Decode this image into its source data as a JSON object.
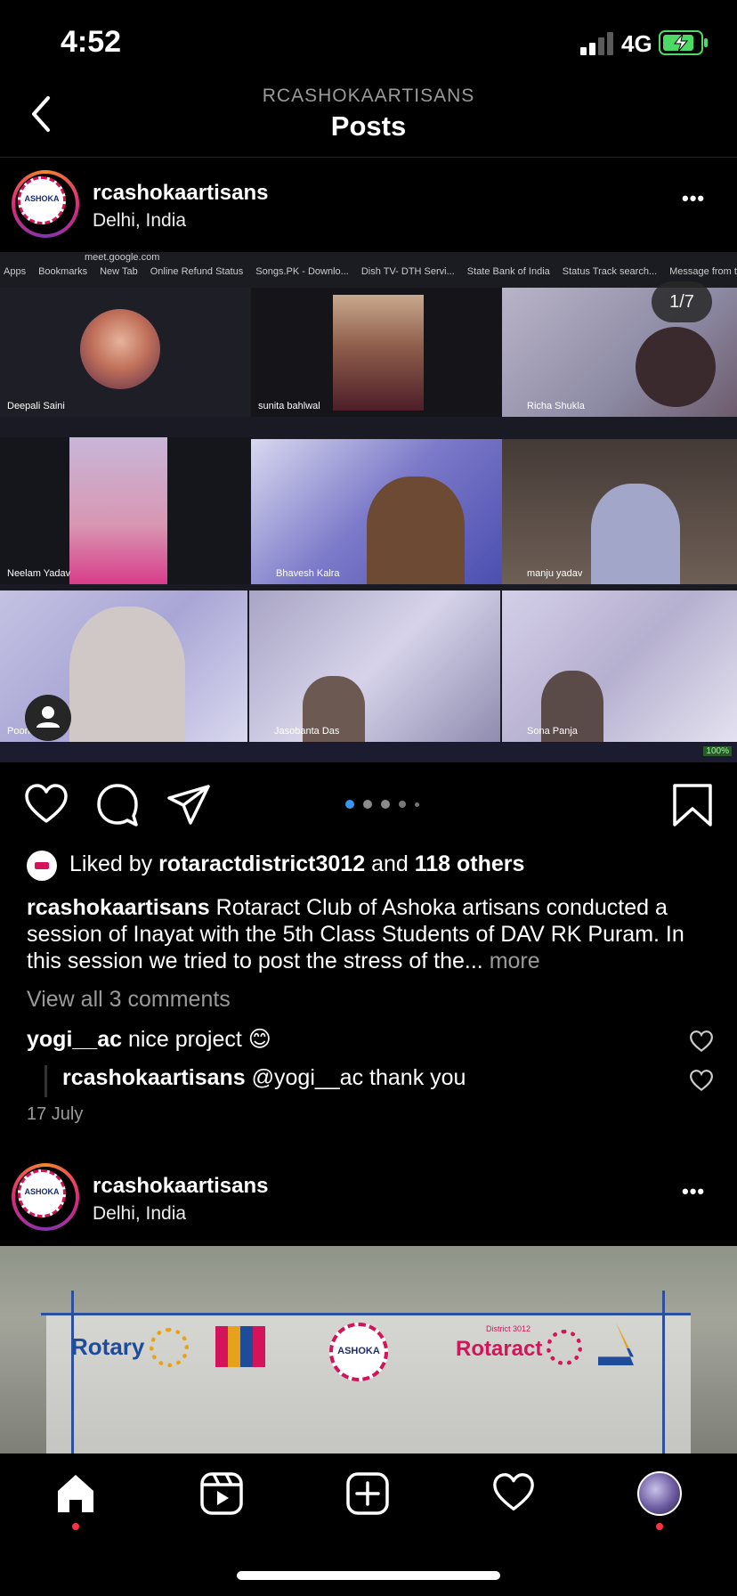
{
  "status_bar": {
    "time": "4:52",
    "network": "4G"
  },
  "header": {
    "account": "RCASHOKAARTISANS",
    "title": "Posts"
  },
  "post1": {
    "username": "rcashokaartisans",
    "location": "Delhi, India",
    "more": "•••",
    "image_counter": "1/7",
    "meeting": {
      "url": "meet.google.com",
      "bookmarks": [
        "Apps",
        "Bookmarks",
        "New Tab",
        "Online Refund Status",
        "Songs.PK - Downlo...",
        "Dish TV- DTH Servi...",
        "State Bank of India",
        "Status Track search...",
        "Message from the..."
      ],
      "participants": [
        "Deepali Saini",
        "sunita bahlwal",
        "Richa Shukla",
        "Neelam Yadav",
        "Bhavesh Kalra",
        "manju yadav",
        "Poonam",
        "Jasobanta Das",
        "Sona Panja"
      ],
      "zoom": "100%"
    },
    "likes_prefix": "Liked by ",
    "likes_user": "rotaractdistrict3012",
    "likes_and": " and ",
    "likes_others": "118 others",
    "caption_user": "rcashokaartisans",
    "caption_text": " Rotaract Club of Ashoka artisans conducted a session of Inayat with the 5th Class Students of DAV RK Puram. In this session we tried to post the stress of the...",
    "caption_more": " more",
    "view_comments": "View all 3 comments",
    "comments": [
      {
        "user": "yogi__ac",
        "text": " nice project 😊"
      },
      {
        "user": "rcashokaartisans",
        "text": " @yogi__ac thank you"
      }
    ],
    "date": "17 July"
  },
  "post2": {
    "username": "rcashokaartisans",
    "location": "Delhi, India",
    "more": "•••",
    "banner": {
      "rotary": "Rotary",
      "ashoka": "ASHOKA",
      "rotaract": "Rotaract",
      "district": "District 3012"
    }
  },
  "avatar_logo_text": "ASHOKA",
  "colors": {
    "accent_blue": "#3797f0",
    "notification": "#ff3040",
    "battery_green": "#4cd964"
  }
}
